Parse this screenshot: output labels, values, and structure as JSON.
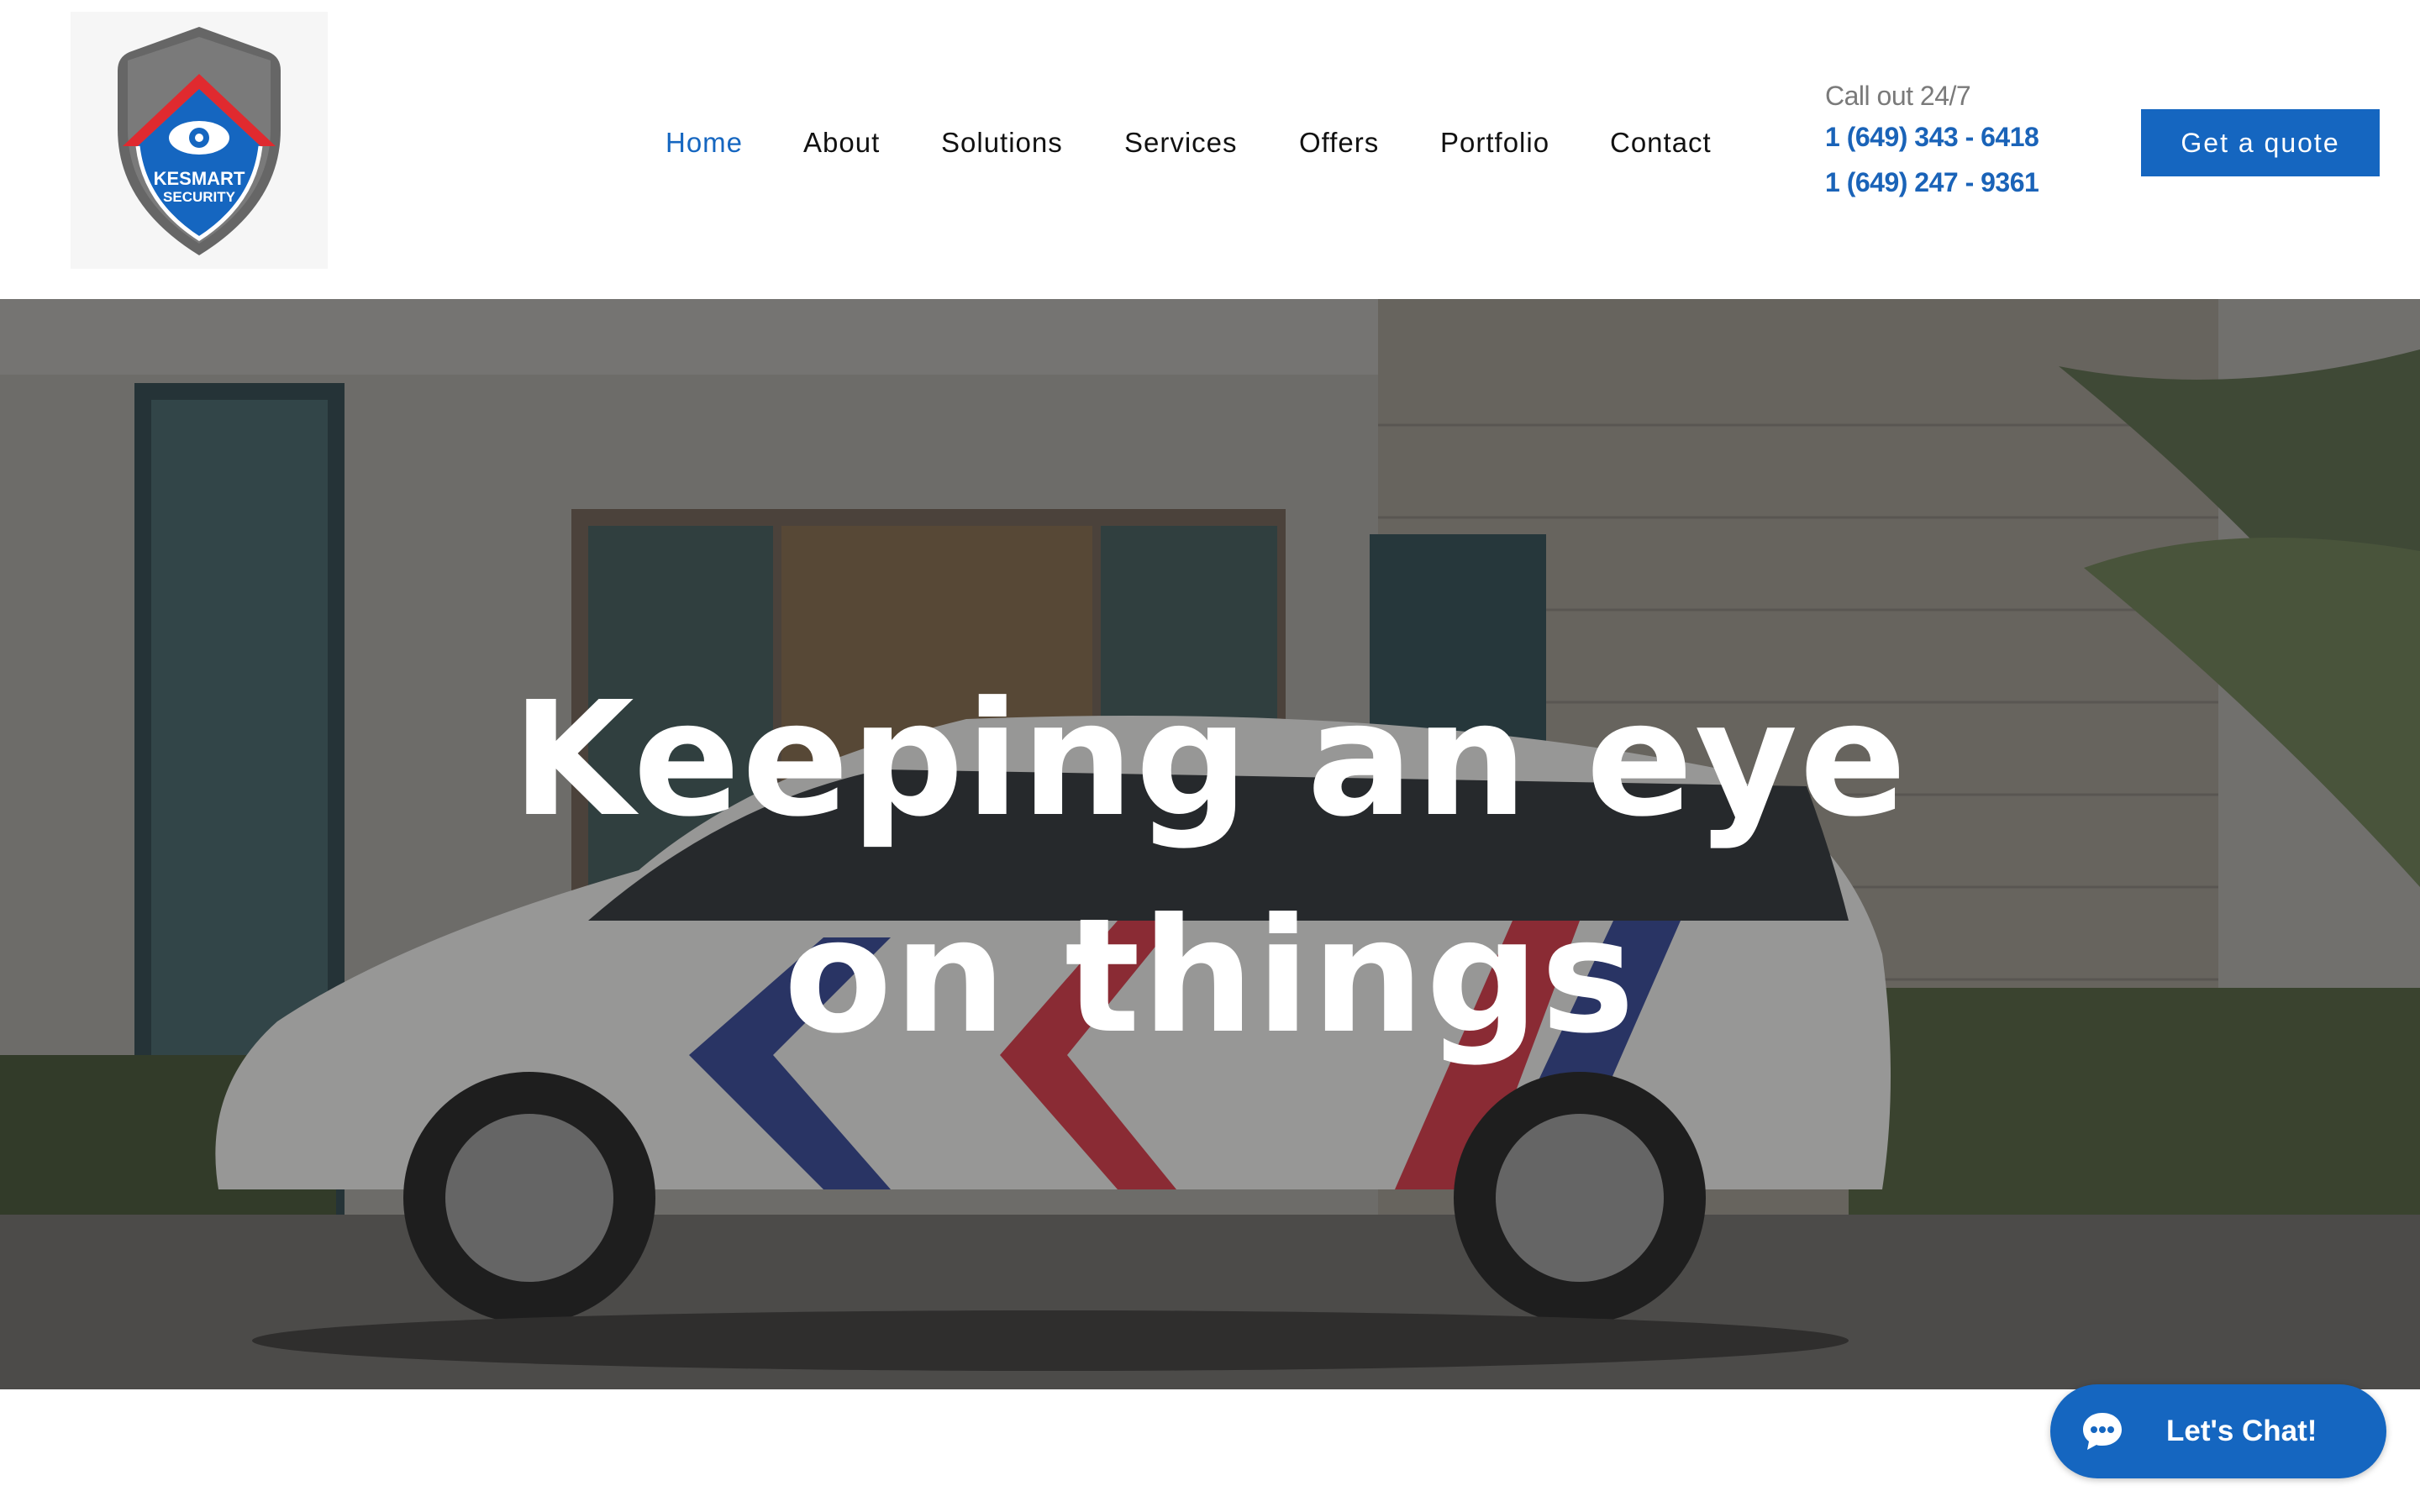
{
  "logo": {
    "line1": "KESMART",
    "line2": "SECURITY"
  },
  "nav": {
    "items": [
      {
        "label": "Home",
        "active": true
      },
      {
        "label": "About",
        "active": false
      },
      {
        "label": "Solutions",
        "active": false
      },
      {
        "label": "Services",
        "active": false
      },
      {
        "label": "Offers",
        "active": false
      },
      {
        "label": "Portfolio",
        "active": false
      },
      {
        "label": "Contact",
        "active": false
      }
    ]
  },
  "callout": {
    "title": "Call out 24/7",
    "phones": [
      "1 (649) 343 - 6418",
      "1 (649) 247 - 9361"
    ]
  },
  "quote_button": "Get a quote",
  "hero": {
    "line1": "Keeping an eye",
    "line2": "on things"
  },
  "chat": {
    "label": "Let's Chat!"
  },
  "colors": {
    "accent": "#1566c0",
    "phone": "#1a63b8",
    "brand_red": "#e02a2f"
  }
}
